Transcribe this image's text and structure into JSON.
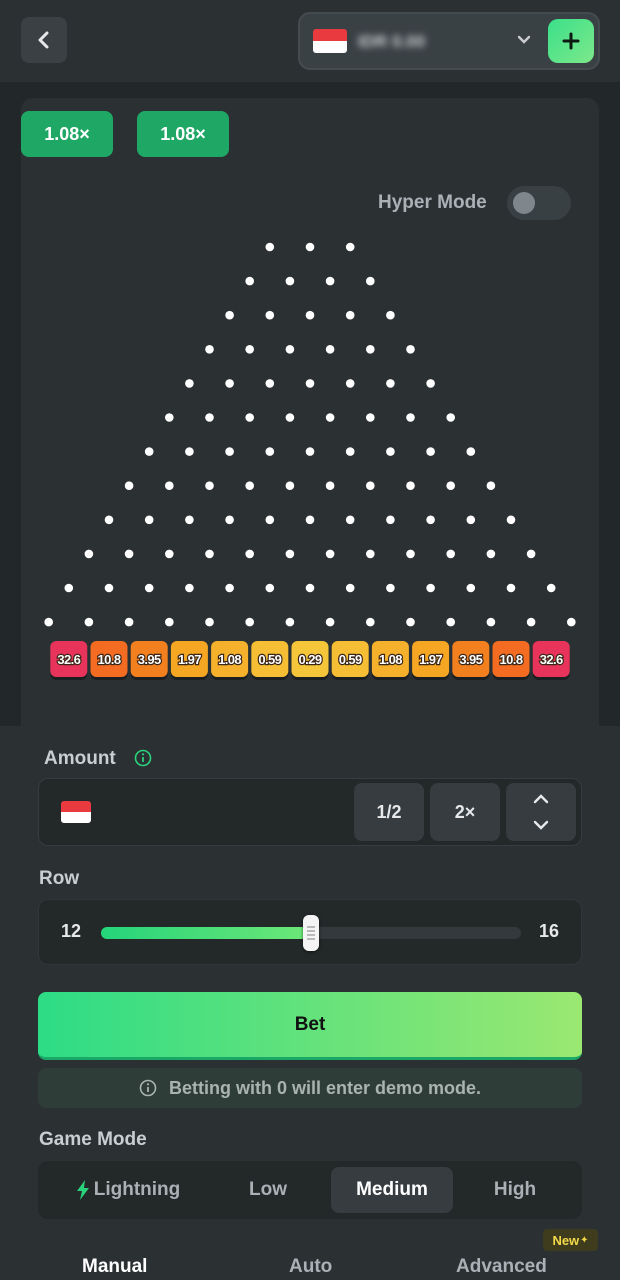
{
  "header": {
    "back_icon": "chevron-left-icon",
    "balance": "IDR 0.00",
    "currency_flag": "indonesia-flag",
    "add_icon": "plus-icon",
    "accent_color": "#3be08a"
  },
  "history": [
    "1.08×",
    "1.08×"
  ],
  "hyper_mode": {
    "label": "Hyper Mode",
    "enabled": false
  },
  "board": {
    "peg_rows": 12,
    "buckets": [
      {
        "label": "32.6",
        "color": "#e8345a"
      },
      {
        "label": "10.8",
        "color": "#f36c22"
      },
      {
        "label": "3.95",
        "color": "#f3801f"
      },
      {
        "label": "1.97",
        "color": "#f5a623"
      },
      {
        "label": "1.08",
        "color": "#f6b12c"
      },
      {
        "label": "0.59",
        "color": "#f6be34"
      },
      {
        "label": "0.29",
        "color": "#f6c63a"
      },
      {
        "label": "0.59",
        "color": "#f6be34"
      },
      {
        "label": "1.08",
        "color": "#f6b12c"
      },
      {
        "label": "1.97",
        "color": "#f5a623"
      },
      {
        "label": "3.95",
        "color": "#f3801f"
      },
      {
        "label": "10.8",
        "color": "#f36c22"
      },
      {
        "label": "32.6",
        "color": "#e8345a"
      }
    ]
  },
  "amount": {
    "label": "Amount",
    "value": "",
    "half_label": "1/2",
    "double_label": "2×"
  },
  "row": {
    "label": "Row",
    "min": "12",
    "max": "16",
    "fill_fraction": 0.5
  },
  "bet_label": "Bet",
  "demo_note": "Betting with 0 will enter demo mode.",
  "game_mode": {
    "label": "Game Mode",
    "options": [
      "Lightning",
      "Low",
      "Medium",
      "High"
    ],
    "selected": "Medium"
  },
  "tabs": [
    "Manual",
    "Auto",
    "Advanced"
  ],
  "new_badge": "New"
}
